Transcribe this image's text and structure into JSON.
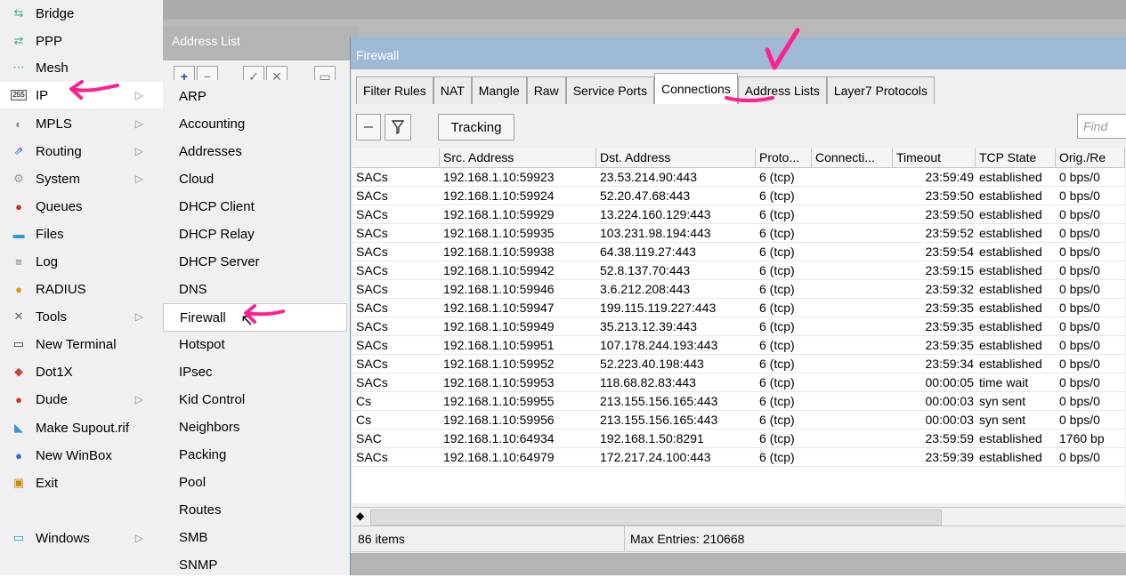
{
  "left_menu": {
    "items": [
      {
        "label": "Bridge",
        "icon": "bridge-icon",
        "arrow": false
      },
      {
        "label": "PPP",
        "icon": "ppp-icon",
        "arrow": false
      },
      {
        "label": "Mesh",
        "icon": "mesh-icon",
        "arrow": false
      },
      {
        "label": "IP",
        "icon": "ip-icon",
        "arrow": true
      },
      {
        "label": "MPLS",
        "icon": "mpls-icon",
        "arrow": true
      },
      {
        "label": "Routing",
        "icon": "routing-icon",
        "arrow": true
      },
      {
        "label": "System",
        "icon": "gear-icon",
        "arrow": true
      },
      {
        "label": "Queues",
        "icon": "queues-icon",
        "arrow": false
      },
      {
        "label": "Files",
        "icon": "folder-icon",
        "arrow": false
      },
      {
        "label": "Log",
        "icon": "log-icon",
        "arrow": false
      },
      {
        "label": "RADIUS",
        "icon": "radius-icon",
        "arrow": false
      },
      {
        "label": "Tools",
        "icon": "tools-icon",
        "arrow": true
      },
      {
        "label": "New Terminal",
        "icon": "terminal-icon",
        "arrow": false
      },
      {
        "label": "Dot1X",
        "icon": "dot1x-icon",
        "arrow": false
      },
      {
        "label": "Dude",
        "icon": "dude-icon",
        "arrow": true
      },
      {
        "label": "Make Supout.rif",
        "icon": "supout-icon",
        "arrow": false
      },
      {
        "label": "New WinBox",
        "icon": "winbox-icon",
        "arrow": false
      },
      {
        "label": "Exit",
        "icon": "exit-icon",
        "arrow": false
      },
      {
        "label": "Windows",
        "icon": "windows-icon",
        "arrow": true
      }
    ],
    "ip_badge": "255"
  },
  "address_list": {
    "title": "Address List"
  },
  "ip_submenu": {
    "items": [
      "ARP",
      "Accounting",
      "Addresses",
      "Cloud",
      "DHCP Client",
      "DHCP Relay",
      "DHCP Server",
      "DNS",
      "Firewall",
      "Hotspot",
      "IPsec",
      "Kid Control",
      "Neighbors",
      "Packing",
      "Pool",
      "Routes",
      "SMB",
      "SNMP"
    ]
  },
  "firewall": {
    "title": "Firewall",
    "tabs": [
      "Filter Rules",
      "NAT",
      "Mangle",
      "Raw",
      "Service Ports",
      "Connections",
      "Address Lists",
      "Layer7 Protocols"
    ],
    "active_tab": "Connections",
    "tracking_label": "Tracking",
    "find_placeholder": "Find",
    "columns": [
      "",
      "Src. Address",
      "Dst. Address",
      "Proto...",
      "Connecti...",
      "Timeout",
      "TCP State",
      "Orig./Re"
    ],
    "rows": [
      [
        "SACs",
        "192.168.1.10:59923",
        "23.53.214.90:443",
        "6 (tcp)",
        "",
        "23:59:49",
        "established",
        "0 bps/0"
      ],
      [
        "SACs",
        "192.168.1.10:59924",
        "52.20.47.68:443",
        "6 (tcp)",
        "",
        "23:59:50",
        "established",
        "0 bps/0"
      ],
      [
        "SACs",
        "192.168.1.10:59929",
        "13.224.160.129:443",
        "6 (tcp)",
        "",
        "23:59:50",
        "established",
        "0 bps/0"
      ],
      [
        "SACs",
        "192.168.1.10:59935",
        "103.231.98.194:443",
        "6 (tcp)",
        "",
        "23:59:52",
        "established",
        "0 bps/0"
      ],
      [
        "SACs",
        "192.168.1.10:59938",
        "64.38.119.27:443",
        "6 (tcp)",
        "",
        "23:59:54",
        "established",
        "0 bps/0"
      ],
      [
        "SACs",
        "192.168.1.10:59942",
        "52.8.137.70:443",
        "6 (tcp)",
        "",
        "23:59:15",
        "established",
        "0 bps/0"
      ],
      [
        "SACs",
        "192.168.1.10:59946",
        "3.6.212.208:443",
        "6 (tcp)",
        "",
        "23:59:32",
        "established",
        "0 bps/0"
      ],
      [
        "SACs",
        "192.168.1.10:59947",
        "199.115.119.227:443",
        "6 (tcp)",
        "",
        "23:59:35",
        "established",
        "0 bps/0"
      ],
      [
        "SACs",
        "192.168.1.10:59949",
        "35.213.12.39:443",
        "6 (tcp)",
        "",
        "23:59:35",
        "established",
        "0 bps/0"
      ],
      [
        "SACs",
        "192.168.1.10:59951",
        "107.178.244.193:443",
        "6 (tcp)",
        "",
        "23:59:35",
        "established",
        "0 bps/0"
      ],
      [
        "SACs",
        "192.168.1.10:59952",
        "52.223.40.198:443",
        "6 (tcp)",
        "",
        "23:59:34",
        "established",
        "0 bps/0"
      ],
      [
        "SACs",
        "192.168.1.10:59953",
        "118.68.82.83:443",
        "6 (tcp)",
        "",
        "00:00:05",
        "time wait",
        "0 bps/0"
      ],
      [
        "Cs",
        "192.168.1.10:59955",
        "213.155.156.165:443",
        "6 (tcp)",
        "",
        "00:00:03",
        "syn sent",
        "0 bps/0"
      ],
      [
        "Cs",
        "192.168.1.10:59956",
        "213.155.156.165:443",
        "6 (tcp)",
        "",
        "00:00:03",
        "syn sent",
        "0 bps/0"
      ],
      [
        "SAC",
        "192.168.1.10:64934",
        "192.168.1.50:8291",
        "6 (tcp)",
        "",
        "23:59:59",
        "established",
        "1760 bp"
      ],
      [
        "SACs",
        "192.168.1.10:64979",
        "172.217.24.100:443",
        "6 (tcp)",
        "",
        "23:59:39",
        "established",
        "0 bps/0"
      ]
    ],
    "items_count": "86 items",
    "max_entries": "Max Entries: 210668"
  },
  "colors": {
    "annotation": "#ff1f8f",
    "title_bar": "#9db9d6"
  }
}
